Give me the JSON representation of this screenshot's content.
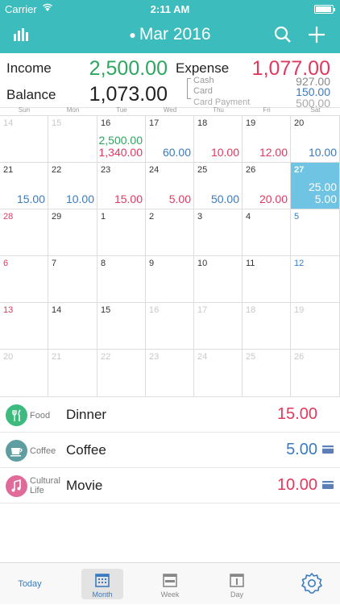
{
  "status": {
    "carrier": "Carrier",
    "time": "2:11 AM"
  },
  "nav": {
    "title": "Mar 2016",
    "left_icon": "chart-icon",
    "search_icon": "search-icon",
    "add_icon": "plus-icon"
  },
  "summary": {
    "income_label": "Income",
    "income_value": "2,500.00",
    "expense_label": "Expense",
    "expense_value": "1,077.00",
    "balance_label": "Balance",
    "balance_value": "1,073.00",
    "cash_label": "Cash",
    "cash_value": "927.00",
    "card_label": "Card",
    "card_value": "150.00",
    "card_payment_label": "Card Payment",
    "card_payment_value": "500.00"
  },
  "weekdays": [
    "Sun",
    "Mon",
    "Tue",
    "Wed",
    "Thu",
    "Fri",
    "Sat"
  ],
  "calendar": {
    "weeks": [
      [
        {
          "d": "14",
          "t": "muted"
        },
        {
          "d": "15",
          "t": "muted"
        },
        {
          "d": "16",
          "amounts": [
            {
              "v": "2,500.00",
              "c": "green"
            },
            {
              "v": "1,340.00",
              "c": "red"
            }
          ]
        },
        {
          "d": "17",
          "amounts": [
            {
              "v": "60.00",
              "c": "blue"
            }
          ]
        },
        {
          "d": "18",
          "amounts": [
            {
              "v": "10.00",
              "c": "red"
            }
          ]
        },
        {
          "d": "19",
          "amounts": [
            {
              "v": "12.00",
              "c": "red"
            }
          ]
        },
        {
          "d": "20",
          "amounts": [
            {
              "v": "10.00",
              "c": "blue"
            }
          ]
        }
      ],
      [
        {
          "d": "21",
          "amounts": [
            {
              "v": "15.00",
              "c": "blue"
            }
          ]
        },
        {
          "d": "22",
          "amounts": [
            {
              "v": "10.00",
              "c": "blue"
            }
          ]
        },
        {
          "d": "23",
          "amounts": [
            {
              "v": "15.00",
              "c": "red"
            }
          ]
        },
        {
          "d": "24",
          "amounts": [
            {
              "v": "5.00",
              "c": "red"
            }
          ]
        },
        {
          "d": "25",
          "amounts": [
            {
              "v": "50.00",
              "c": "blue"
            }
          ]
        },
        {
          "d": "26",
          "amounts": [
            {
              "v": "20.00",
              "c": "red"
            }
          ]
        },
        {
          "d": "27",
          "t": "selected",
          "amounts": [
            {
              "v": "25.00",
              "c": "white"
            },
            {
              "v": "5.00",
              "c": "white"
            }
          ]
        }
      ],
      [
        {
          "d": "28",
          "t": "red"
        },
        {
          "d": "29"
        },
        {
          "d": "1"
        },
        {
          "d": "2"
        },
        {
          "d": "3"
        },
        {
          "d": "4"
        },
        {
          "d": "5",
          "t": "blue"
        }
      ],
      [
        {
          "d": "6",
          "t": "red"
        },
        {
          "d": "7"
        },
        {
          "d": "8"
        },
        {
          "d": "9"
        },
        {
          "d": "10"
        },
        {
          "d": "11"
        },
        {
          "d": "12",
          "t": "blue"
        }
      ],
      [
        {
          "d": "13",
          "t": "red"
        },
        {
          "d": "14"
        },
        {
          "d": "15"
        },
        {
          "d": "16",
          "t": "muted"
        },
        {
          "d": "17",
          "t": "muted"
        },
        {
          "d": "18",
          "t": "muted"
        },
        {
          "d": "19",
          "t": "muted"
        }
      ],
      [
        {
          "d": "20",
          "t": "muted"
        },
        {
          "d": "21",
          "t": "muted"
        },
        {
          "d": "22",
          "t": "muted"
        },
        {
          "d": "23",
          "t": "muted"
        },
        {
          "d": "24",
          "t": "muted"
        },
        {
          "d": "25",
          "t": "muted"
        },
        {
          "d": "26",
          "t": "muted"
        }
      ]
    ]
  },
  "transactions": [
    {
      "category": "Food",
      "icon": "fork-knife-icon",
      "color": "#3dbb7f",
      "title": "Dinner",
      "amount": "15.00",
      "amount_color": "red",
      "card": false
    },
    {
      "category": "Coffee",
      "icon": "coffee-cup-icon",
      "color": "#5f9ea0",
      "title": "Coffee",
      "amount": "5.00",
      "amount_color": "blue",
      "card": true
    },
    {
      "category": "Cultural Life",
      "icon": "music-note-icon",
      "color": "#e06a9a",
      "title": "Movie",
      "amount": "10.00",
      "amount_color": "red",
      "card": true
    }
  ],
  "tabs": {
    "today": "Today",
    "month": "Month",
    "week": "Week",
    "day": "Day",
    "settings_icon": "gear-icon"
  },
  "colors": {
    "accent": "#3cbcbd",
    "income": "#2ea660",
    "expense": "#e2385f",
    "blue": "#3a7bc0",
    "selected": "#6fc3e3"
  }
}
